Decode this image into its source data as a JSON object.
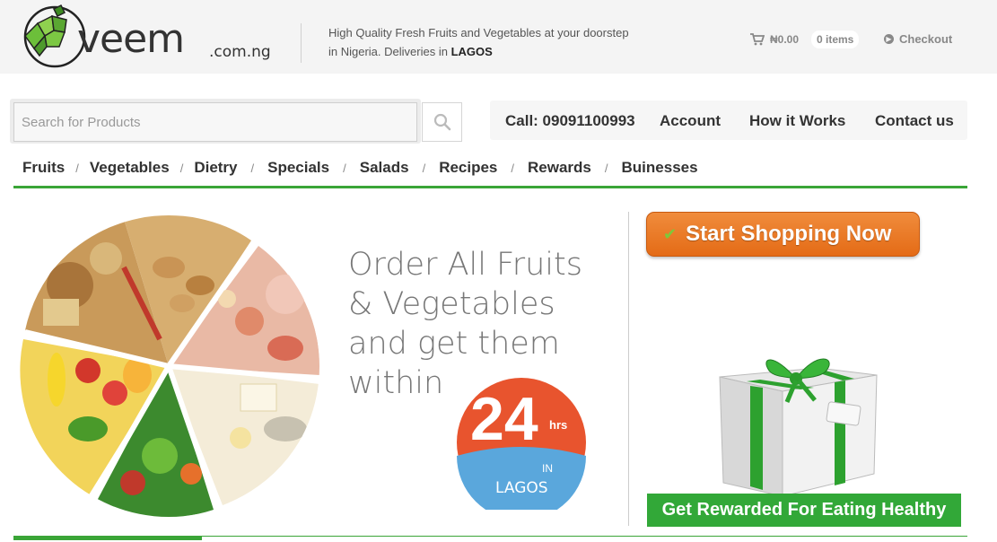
{
  "brand": {
    "logo_text": "veem",
    "logo_suffix": ".com.ng"
  },
  "header": {
    "tagline_line1": "High Quality Fresh Fruits and Vegetables at your doorstep",
    "tagline_line2_prefix": "in Nigeria. Deliveries in",
    "tagline_city": "LAGOS",
    "cart_total": "₦0.00",
    "cart_items": "0 items",
    "checkout_label": "Checkout"
  },
  "search": {
    "placeholder": "Search for Products",
    "value": ""
  },
  "topnav": {
    "call": "Call: 09091100993",
    "account": "Account",
    "how_it_works": "How it Works",
    "contact": "Contact us"
  },
  "categories": [
    "Fruits",
    "Vegetables",
    "Dietry",
    "Specials",
    "Salads",
    "Recipes",
    "Rewards",
    "Buinesses"
  ],
  "hero": {
    "line1": "Order All Fruits",
    "line2": "& Vegetables",
    "line3": "and get them",
    "line4": "within",
    "badge_number": "24",
    "badge_unit": "hrs",
    "badge_in": "IN",
    "badge_city": "LAGOS"
  },
  "cta": {
    "shop_label": "Start Shopping Now",
    "reward_label": "Get Rewarded For Eating Healthy"
  },
  "colors": {
    "accent_green": "#3aa537",
    "cta_orange": "#e97a26",
    "badge_red": "#e8542e",
    "badge_blue": "#5aa7dc"
  },
  "icons": {
    "cart": "cart-icon",
    "checkout": "arrow-circle-icon",
    "search": "search-icon",
    "check": "check-icon",
    "gift": "gift-icon"
  }
}
